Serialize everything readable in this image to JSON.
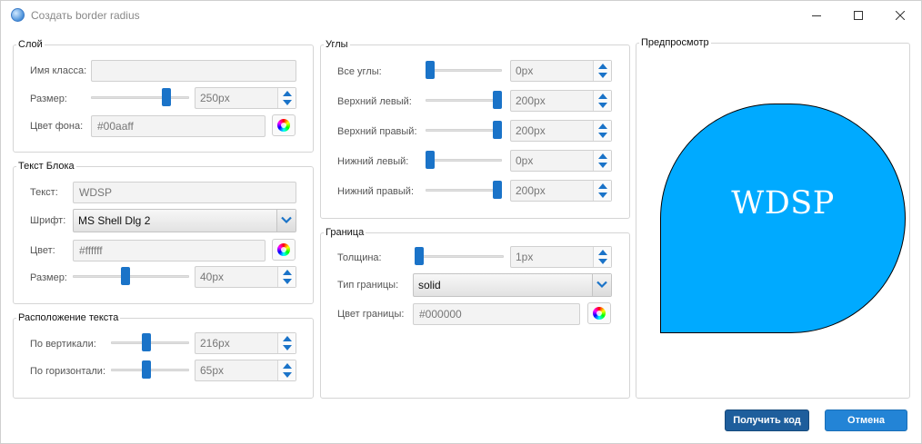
{
  "window": {
    "title": "Создать border radius"
  },
  "layer": {
    "group_title": "Слой",
    "class_label": "Имя класса:",
    "class_value": "",
    "size_label": "Размер:",
    "size_value": "250px",
    "size_slider": 0.8,
    "bg_label": "Цвет фона:",
    "bg_value": "#00aaff"
  },
  "text_block": {
    "group_title": "Текст Блока",
    "text_label": "Текст:",
    "text_value": "WDSP",
    "font_label": "Шрифт:",
    "font_value": "MS Shell Dlg 2",
    "color_label": "Цвет:",
    "color_value": "#ffffff",
    "size_label": "Размер:",
    "size_value": "40px",
    "size_slider": 0.45
  },
  "text_position": {
    "group_title": "Расположение текста",
    "vertical_label": "По вертикали:",
    "vertical_value": "216px",
    "vertical_slider": 0.45,
    "horizontal_label": "По горизонтали:",
    "horizontal_value": "65px",
    "horizontal_slider": 0.45
  },
  "corners": {
    "group_title": "Углы",
    "all_label": "Все углы:",
    "all_value": "0px",
    "all_slider": 0.0,
    "top_left_label": "Верхний левый:",
    "top_left_value": "200px",
    "top_left_slider": 1.0,
    "top_right_label": "Верхний правый:",
    "top_right_value": "200px",
    "top_right_slider": 1.0,
    "bottom_left_label": "Нижний левый:",
    "bottom_left_value": "0px",
    "bottom_left_slider": 0.0,
    "bottom_right_label": "Нижний правый:",
    "bottom_right_value": "200px",
    "bottom_right_slider": 1.0
  },
  "border": {
    "group_title": "Граница",
    "width_label": "Толщина:",
    "width_value": "1px",
    "width_slider": 0.0,
    "type_label": "Тип границы:",
    "type_value": "solid",
    "color_label": "Цвет границы:",
    "color_value": "#000000"
  },
  "preview": {
    "group_title": "Предпросмотр",
    "text": "WDSP",
    "bg_color": "#00aaff",
    "text_color": "#ffffff",
    "border_color": "#000000"
  },
  "buttons": {
    "get_code": "Получить код",
    "cancel": "Отмена"
  },
  "icons": {
    "app": "app-globe-icon",
    "minimize": "minimize-icon",
    "maximize": "maximize-icon",
    "close": "close-icon",
    "spin_up": "arrow-up-icon",
    "spin_down": "arrow-down-icon",
    "dropdown": "chevron-down-icon",
    "color_picker": "color-wheel-icon"
  },
  "colors": {
    "accent": "#1a73c8",
    "primary_button": "#1e5e9c",
    "cancel_button": "#2384d6"
  }
}
